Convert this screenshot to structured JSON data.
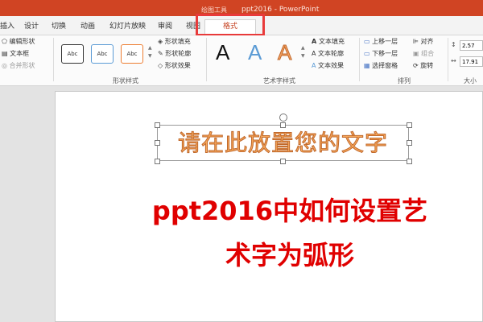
{
  "title_bar": {
    "drawing_tools": "绘图工具",
    "title": "ppt2016 - PowerPoint"
  },
  "tabs": [
    "插入",
    "设计",
    "切换",
    "动画",
    "幻灯片放映",
    "审阅",
    "视图",
    "格式"
  ],
  "ribbon": {
    "insert_shapes": {
      "edit_shape": "编辑形状",
      "text_box": "文本框",
      "merge_shapes": "合并形状"
    },
    "shape_styles": {
      "label": "形状样式",
      "thumbnails": [
        "Abc",
        "Abc",
        "Abc"
      ],
      "fill": "形状填充",
      "outline": "形状轮廓",
      "effects": "形状效果"
    },
    "wordart": {
      "label": "艺术字样式",
      "samples": [
        "A",
        "A",
        "A"
      ],
      "fill": "文本填充",
      "outline": "文本轮廓",
      "effects": "文本效果"
    },
    "arrange": {
      "label": "排列",
      "bring_forward": "上移一层",
      "send_backward": "下移一层",
      "selection_pane": "选择窗格",
      "align": "对齐",
      "group": "组合",
      "rotate": "旋转"
    },
    "size": {
      "label": "大小",
      "height": "2.57",
      "width": "17.91"
    }
  },
  "slide": {
    "placeholder_text": "请在此放置您的文字",
    "heading_line1": "ppt2016中如何设置艺",
    "heading_line2": "术字为弧形"
  },
  "colors": {
    "accent": "#d04423",
    "highlight_box": "#e83a3a",
    "heading_text": "#e00000",
    "wordart_orange": "#f7a85a"
  }
}
